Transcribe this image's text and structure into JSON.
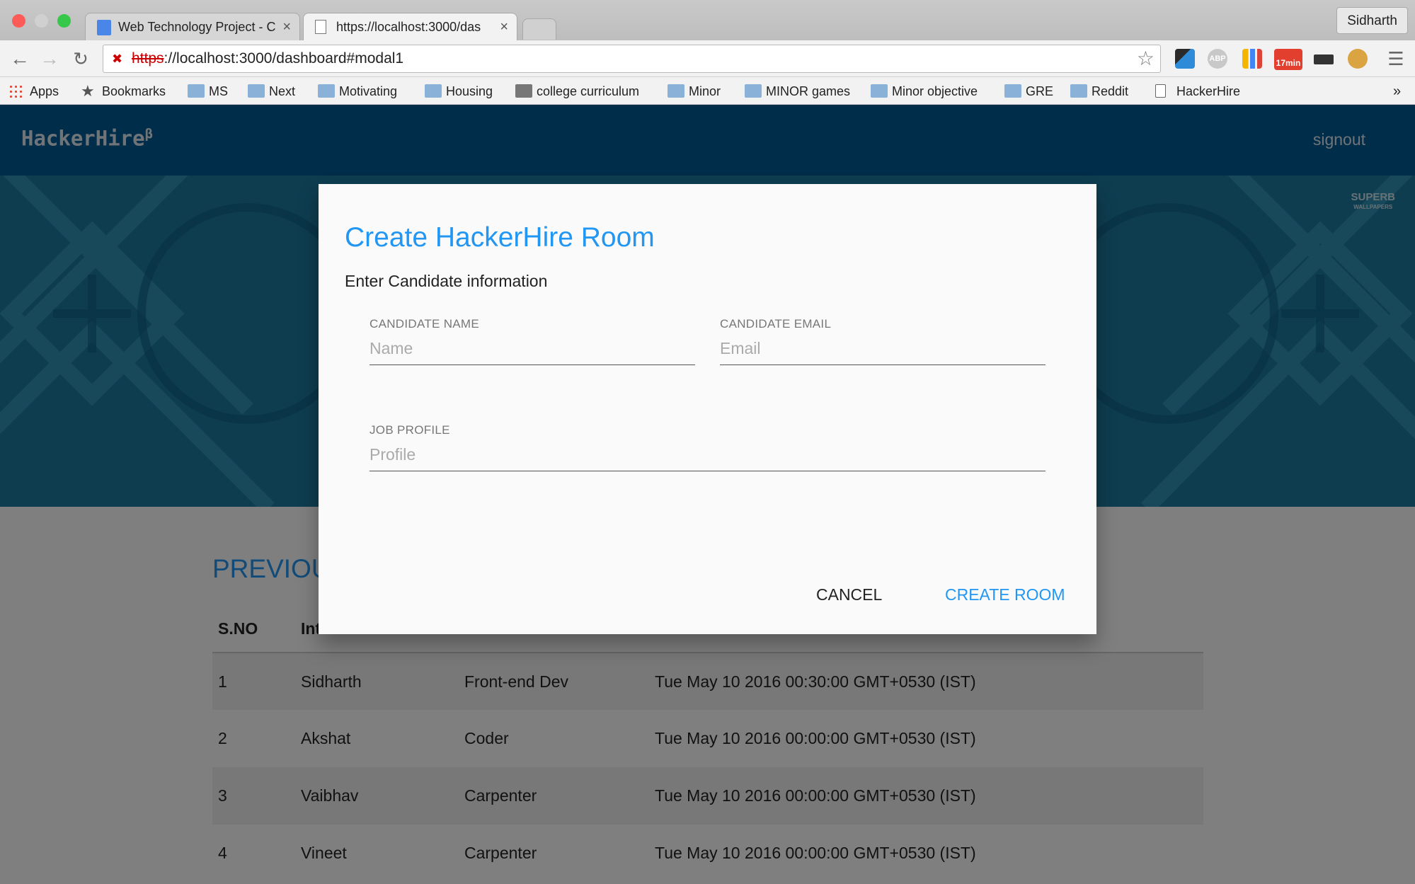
{
  "browser": {
    "tabs": [
      {
        "title": "Web Technology Project - C",
        "active": false
      },
      {
        "title": "https://localhost:3000/das",
        "active": true
      }
    ],
    "profile": "Sidharth",
    "url": {
      "scheme": "https",
      "rest": "://localhost:3000/dashboard#modal1"
    },
    "bookmarks": [
      "Apps",
      "Bookmarks",
      "MS",
      "Next",
      "Motivating",
      "Housing",
      "college curriculum",
      "Minor",
      "MINOR games",
      "Minor objective",
      "GRE",
      "Reddit",
      "HackerHire"
    ],
    "overflow": "»",
    "extension_badge": "17min"
  },
  "app": {
    "brand": "HackerHire",
    "brand_sup": "β",
    "signout": "signout",
    "watermark": "SUPERB",
    "watermark_sub": "WALLPAPERS"
  },
  "section": {
    "title": "PREVIOU"
  },
  "table": {
    "headers": [
      "S.NO",
      "Int",
      "",
      ""
    ],
    "rows": [
      [
        "1",
        "Sidharth",
        "Front-end Dev",
        "Tue May 10 2016 00:30:00 GMT+0530 (IST)"
      ],
      [
        "2",
        "Akshat",
        "Coder",
        "Tue May 10 2016 00:00:00 GMT+0530 (IST)"
      ],
      [
        "3",
        "Vaibhav",
        "Carpenter",
        "Tue May 10 2016 00:00:00 GMT+0530 (IST)"
      ],
      [
        "4",
        "Vineet",
        "Carpenter",
        "Tue May 10 2016 00:00:00 GMT+0530 (IST)"
      ]
    ]
  },
  "modal": {
    "title": "Create HackerHire Room",
    "subtitle": "Enter Candidate information",
    "fields": {
      "name": {
        "label": "CANDIDATE NAME",
        "placeholder": "Name",
        "value": ""
      },
      "email": {
        "label": "CANDIDATE EMAIL",
        "placeholder": "Email",
        "value": ""
      },
      "profile": {
        "label": "JOB PROFILE",
        "placeholder": "Profile",
        "value": ""
      }
    },
    "cancel": "CANCEL",
    "create": "CREATE ROOM"
  },
  "colors": {
    "accent": "#2196f3",
    "navbar": "#005b93",
    "hero": "#1d7aa0"
  }
}
